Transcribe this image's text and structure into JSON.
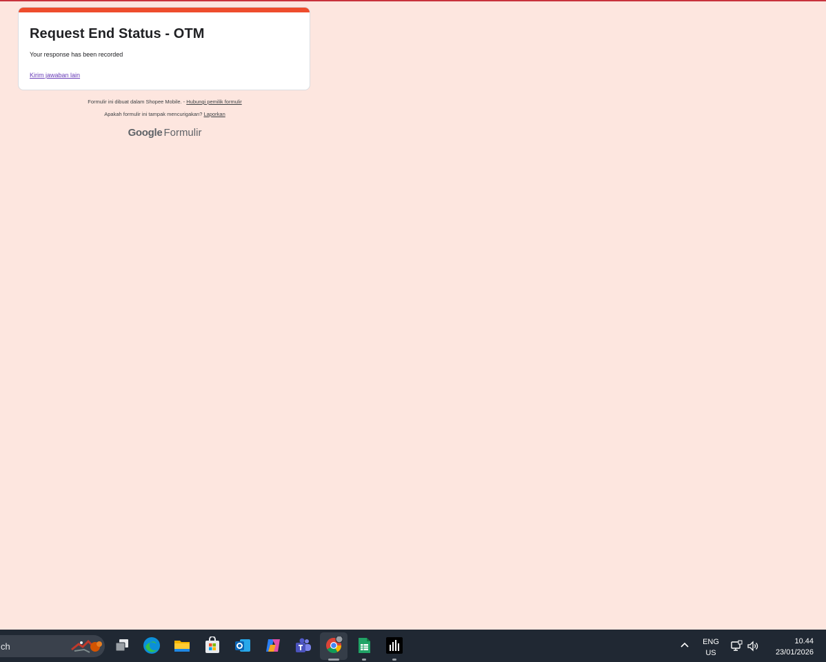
{
  "form": {
    "title": "Request End Status - OTM",
    "confirmation": "Your response has been recorded",
    "another_response_link": "Kirim jawaban lain",
    "accent_color": "#ee4d2d"
  },
  "footer": {
    "created_text": "Formulir ini dibuat dalam Shopee Mobile. -",
    "contact_link": "Hubungi pemilik formulir",
    "suspicious_text": "Apakah formulir ini tampak mencurigakan?",
    "report_link": "Laporkan",
    "brand_google": "Google",
    "brand_product": "Formulir"
  },
  "taskbar": {
    "search_text": "ch",
    "apps": [
      {
        "name": "task-view-icon"
      },
      {
        "name": "edge-icon"
      },
      {
        "name": "file-explorer-icon"
      },
      {
        "name": "microsoft-store-icon"
      },
      {
        "name": "outlook-icon"
      },
      {
        "name": "copilot-icon"
      },
      {
        "name": "teams-icon"
      },
      {
        "name": "chrome-icon",
        "active": true
      },
      {
        "name": "sheets-icon"
      },
      {
        "name": "audio-meter-icon"
      }
    ],
    "language_line1": "ENG",
    "language_line2": "US",
    "time": "10.44",
    "date": "23/01/2026"
  },
  "colors": {
    "page_background": "#fde6df",
    "taskbar_background": "#202833",
    "link_color": "#673ab7"
  }
}
